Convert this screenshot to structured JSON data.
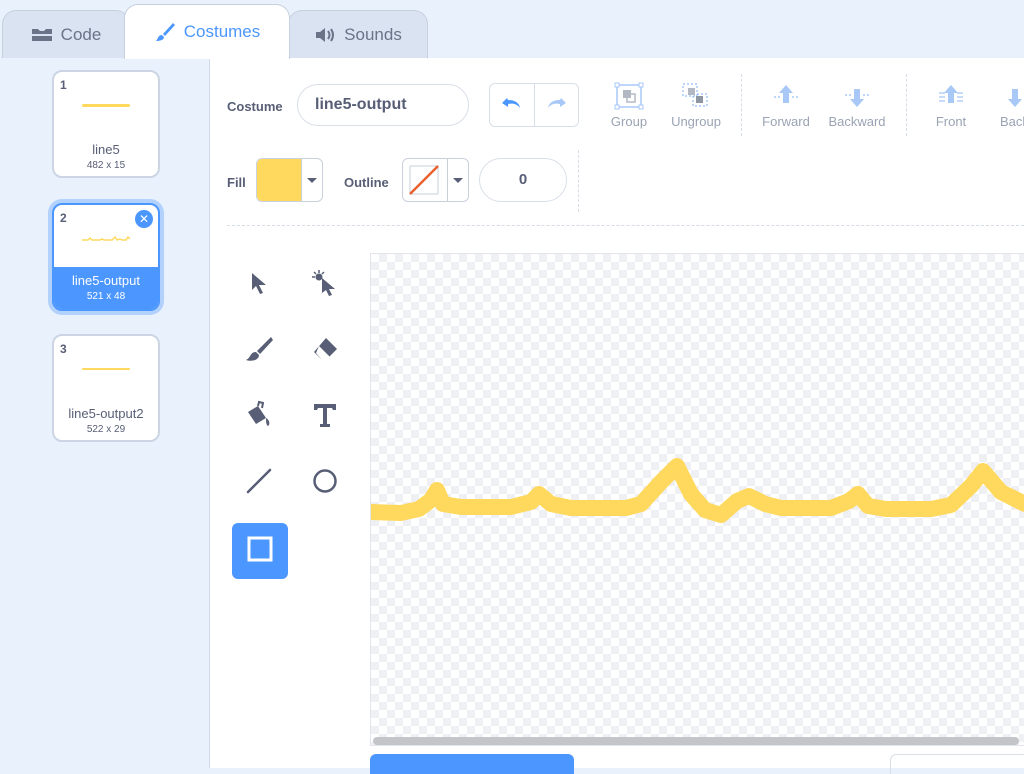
{
  "tabs": [
    {
      "label": "Code",
      "icon": "code-blocks-icon"
    },
    {
      "label": "Costumes",
      "icon": "paintbrush-icon",
      "active": true
    },
    {
      "label": "Sounds",
      "icon": "speaker-icon"
    }
  ],
  "costumes": [
    {
      "number": "1",
      "name": "line5",
      "size": "482 x 15"
    },
    {
      "number": "2",
      "name": "line5-output",
      "size": "521 x 48",
      "selected": true
    },
    {
      "number": "3",
      "name": "line5-output2",
      "size": "522 x 29"
    }
  ],
  "toolbar": {
    "costume_label": "Costume",
    "costume_name": "line5-output",
    "group_label": "Group",
    "ungroup_label": "Ungroup",
    "forward_label": "Forward",
    "backward_label": "Backward",
    "front_label": "Front",
    "back_label": "Back",
    "fill_label": "Fill",
    "outline_label": "Outline",
    "outline_width": "0"
  },
  "colors": {
    "accent": "#4c97ff",
    "fill": "#ffd95e",
    "outline_none_slash": "#e8602c"
  },
  "tools": [
    "select-tool",
    "reshape-tool",
    "brush-tool",
    "eraser-tool",
    "fill-tool",
    "text-tool",
    "line-tool",
    "circle-tool",
    "rectangle-tool"
  ],
  "active_tool": "rectangle-tool"
}
